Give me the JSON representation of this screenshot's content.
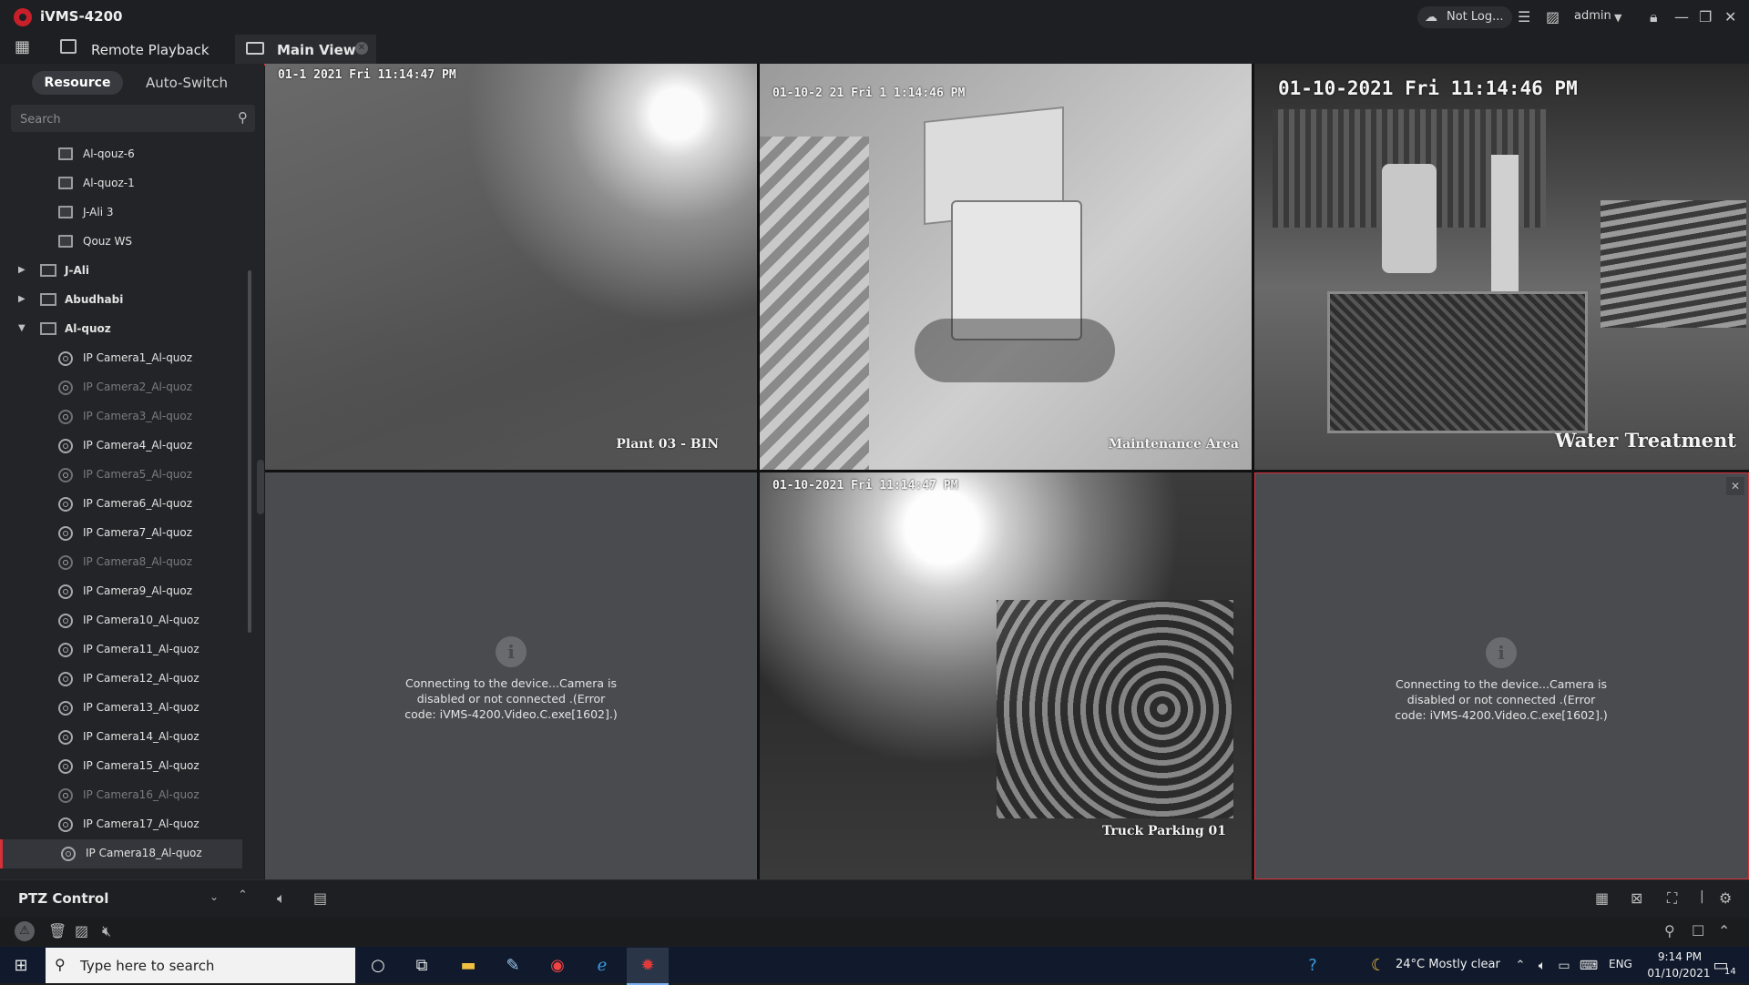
{
  "app": {
    "title": "iVMS-4200",
    "cloud_status": "Not Log...",
    "user": "admin"
  },
  "tabs": [
    {
      "label": "Remote Playback"
    },
    {
      "label": "Main View"
    }
  ],
  "sidebar": {
    "tabs": [
      "Resource",
      "Auto-Switch"
    ],
    "search_placeholder": "Search",
    "tree": [
      {
        "label": "Al-qouz-6",
        "type": "view"
      },
      {
        "label": "Al-quoz-1",
        "type": "view"
      },
      {
        "label": "J-Ali 3",
        "type": "view"
      },
      {
        "label": "Qouz WS",
        "type": "view"
      },
      {
        "label": "J-Ali",
        "type": "folder"
      },
      {
        "label": "Abudhabi",
        "type": "folder"
      },
      {
        "label": "Al-quoz",
        "type": "folder"
      },
      {
        "label": "IP Camera1_Al-quoz",
        "type": "camera"
      },
      {
        "label": "IP Camera2_Al-quoz",
        "type": "camera"
      },
      {
        "label": "IP Camera3_Al-quoz",
        "type": "camera"
      },
      {
        "label": "IP Camera4_Al-quoz",
        "type": "camera"
      },
      {
        "label": "IP Camera5_Al-quoz",
        "type": "camera"
      },
      {
        "label": "IP Camera6_Al-quoz",
        "type": "camera"
      },
      {
        "label": "IP Camera7_Al-quoz",
        "type": "camera"
      },
      {
        "label": "IP Camera8_Al-quoz",
        "type": "camera"
      },
      {
        "label": "IP Camera9_Al-quoz",
        "type": "camera"
      },
      {
        "label": "IP Camera10_Al-quoz",
        "type": "camera"
      },
      {
        "label": "IP Camera11_Al-quoz",
        "type": "camera"
      },
      {
        "label": "IP Camera12_Al-quoz",
        "type": "camera"
      },
      {
        "label": "IP Camera13_Al-quoz",
        "type": "camera"
      },
      {
        "label": "IP Camera14_Al-quoz",
        "type": "camera"
      },
      {
        "label": "IP Camera15_Al-quoz",
        "type": "camera"
      },
      {
        "label": "IP Camera16_Al-quoz",
        "type": "camera"
      },
      {
        "label": "IP Camera17_Al-quoz",
        "type": "camera"
      },
      {
        "label": "IP Camera18_Al-quoz",
        "type": "camera"
      }
    ]
  },
  "tiles": [
    {
      "timestamp": "01-1 2021 Fri 11:14:47 PM",
      "name": "Plant 03 - BIN"
    },
    {
      "timestamp": "01-10-2 21 Fri 1 1:14:46 PM",
      "name": "Maintenance Area"
    },
    {
      "timestamp": "01-10-2021 Fri 11:14:46 PM",
      "name": "Water Treatment"
    },
    {
      "message": "Connecting to the device...Camera is disabled or not connected .(Error code: iVMS-4200.Video.C.exe[1602].)"
    },
    {
      "timestamp": "01-10-2021 Fri 11:14:47 PM",
      "name": "Truck Parking 01"
    },
    {
      "message": "Connecting to the device...Camera is disabled or not connected .(Error code: iVMS-4200.Video.C.exe[1602].)"
    }
  ],
  "ptz": {
    "label": "PTZ Control"
  },
  "taskbar": {
    "search_placeholder": "Type here to search",
    "weather": "24°C  Mostly clear",
    "language": "ENG",
    "time": "9:14 PM",
    "date": "01/10/2021",
    "notifications": "14"
  },
  "icons": [
    "hikvision-logo-icon",
    "cloud-icon",
    "list-icon",
    "image-icon",
    "lock-icon",
    "minimize-icon",
    "restore-icon",
    "close-icon",
    "grid-menu-icon",
    "playback-icon",
    "main-view-icon",
    "search-icon",
    "info-icon",
    "volume-icon",
    "stop-all-icon",
    "layout-icon",
    "close-all-icon",
    "fullscreen-icon",
    "settings-icon",
    "alarm-icon",
    "trash-icon",
    "picture-icon",
    "mute-icon",
    "pin-icon",
    "window-icon",
    "collapse-icon"
  ]
}
